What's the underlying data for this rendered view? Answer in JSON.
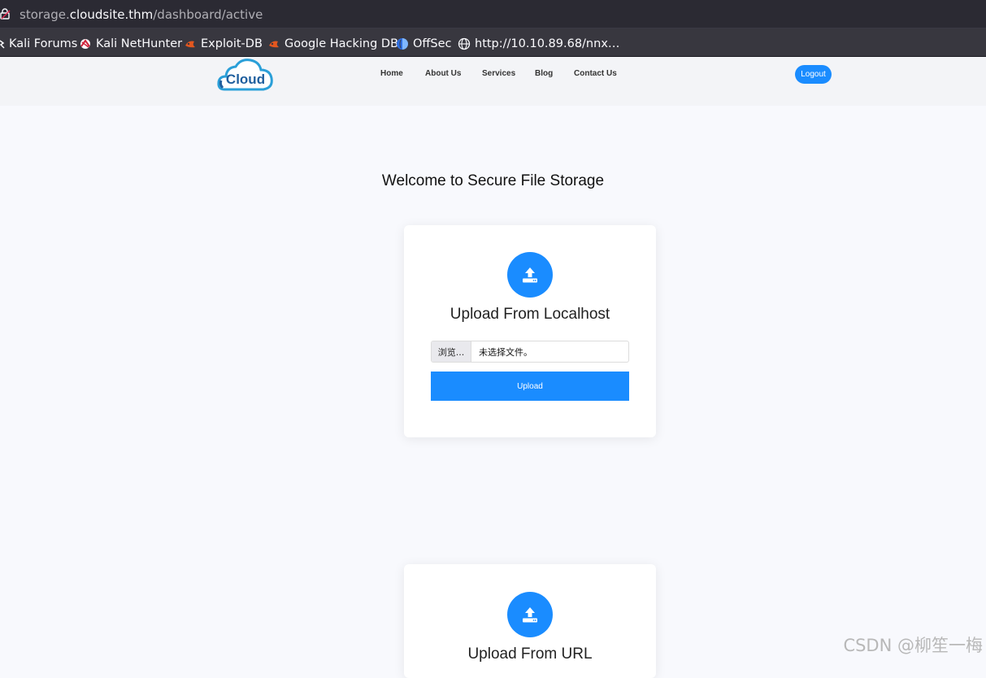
{
  "browser": {
    "url_prefix": "storage.",
    "url_host": "cloudsite.thm",
    "url_path": "/dashboard/active",
    "bookmarks": [
      {
        "label": "Kali Forums",
        "icon": "kali-dragon-icon"
      },
      {
        "label": "Kali NetHunter",
        "icon": "nethunter-icon"
      },
      {
        "label": "Exploit-DB",
        "icon": "exploitdb-icon"
      },
      {
        "label": "Google Hacking DB",
        "icon": "ghdb-icon"
      },
      {
        "label": "OffSec",
        "icon": "offsec-icon"
      },
      {
        "label": "http://10.10.89.68/nnx…",
        "icon": "globe-icon"
      }
    ]
  },
  "site": {
    "logo_text": "Cloud",
    "nav": [
      "Home",
      "About Us",
      "Services",
      "Blog",
      "Contact Us"
    ],
    "logout_label": "Logout"
  },
  "main": {
    "title": "Welcome to Secure File Storage",
    "local_card": {
      "title": "Upload From Localhost",
      "browse_label": "浏览...",
      "file_status": "未选择文件。",
      "upload_label": "Upload"
    },
    "url_card": {
      "title": "Upload From URL"
    }
  },
  "watermark": "CSDN @柳笙一梅",
  "colors": {
    "accent": "#1a8cff",
    "browser_bg": "#2b2a33",
    "page_bg": "#f8f9fd"
  }
}
